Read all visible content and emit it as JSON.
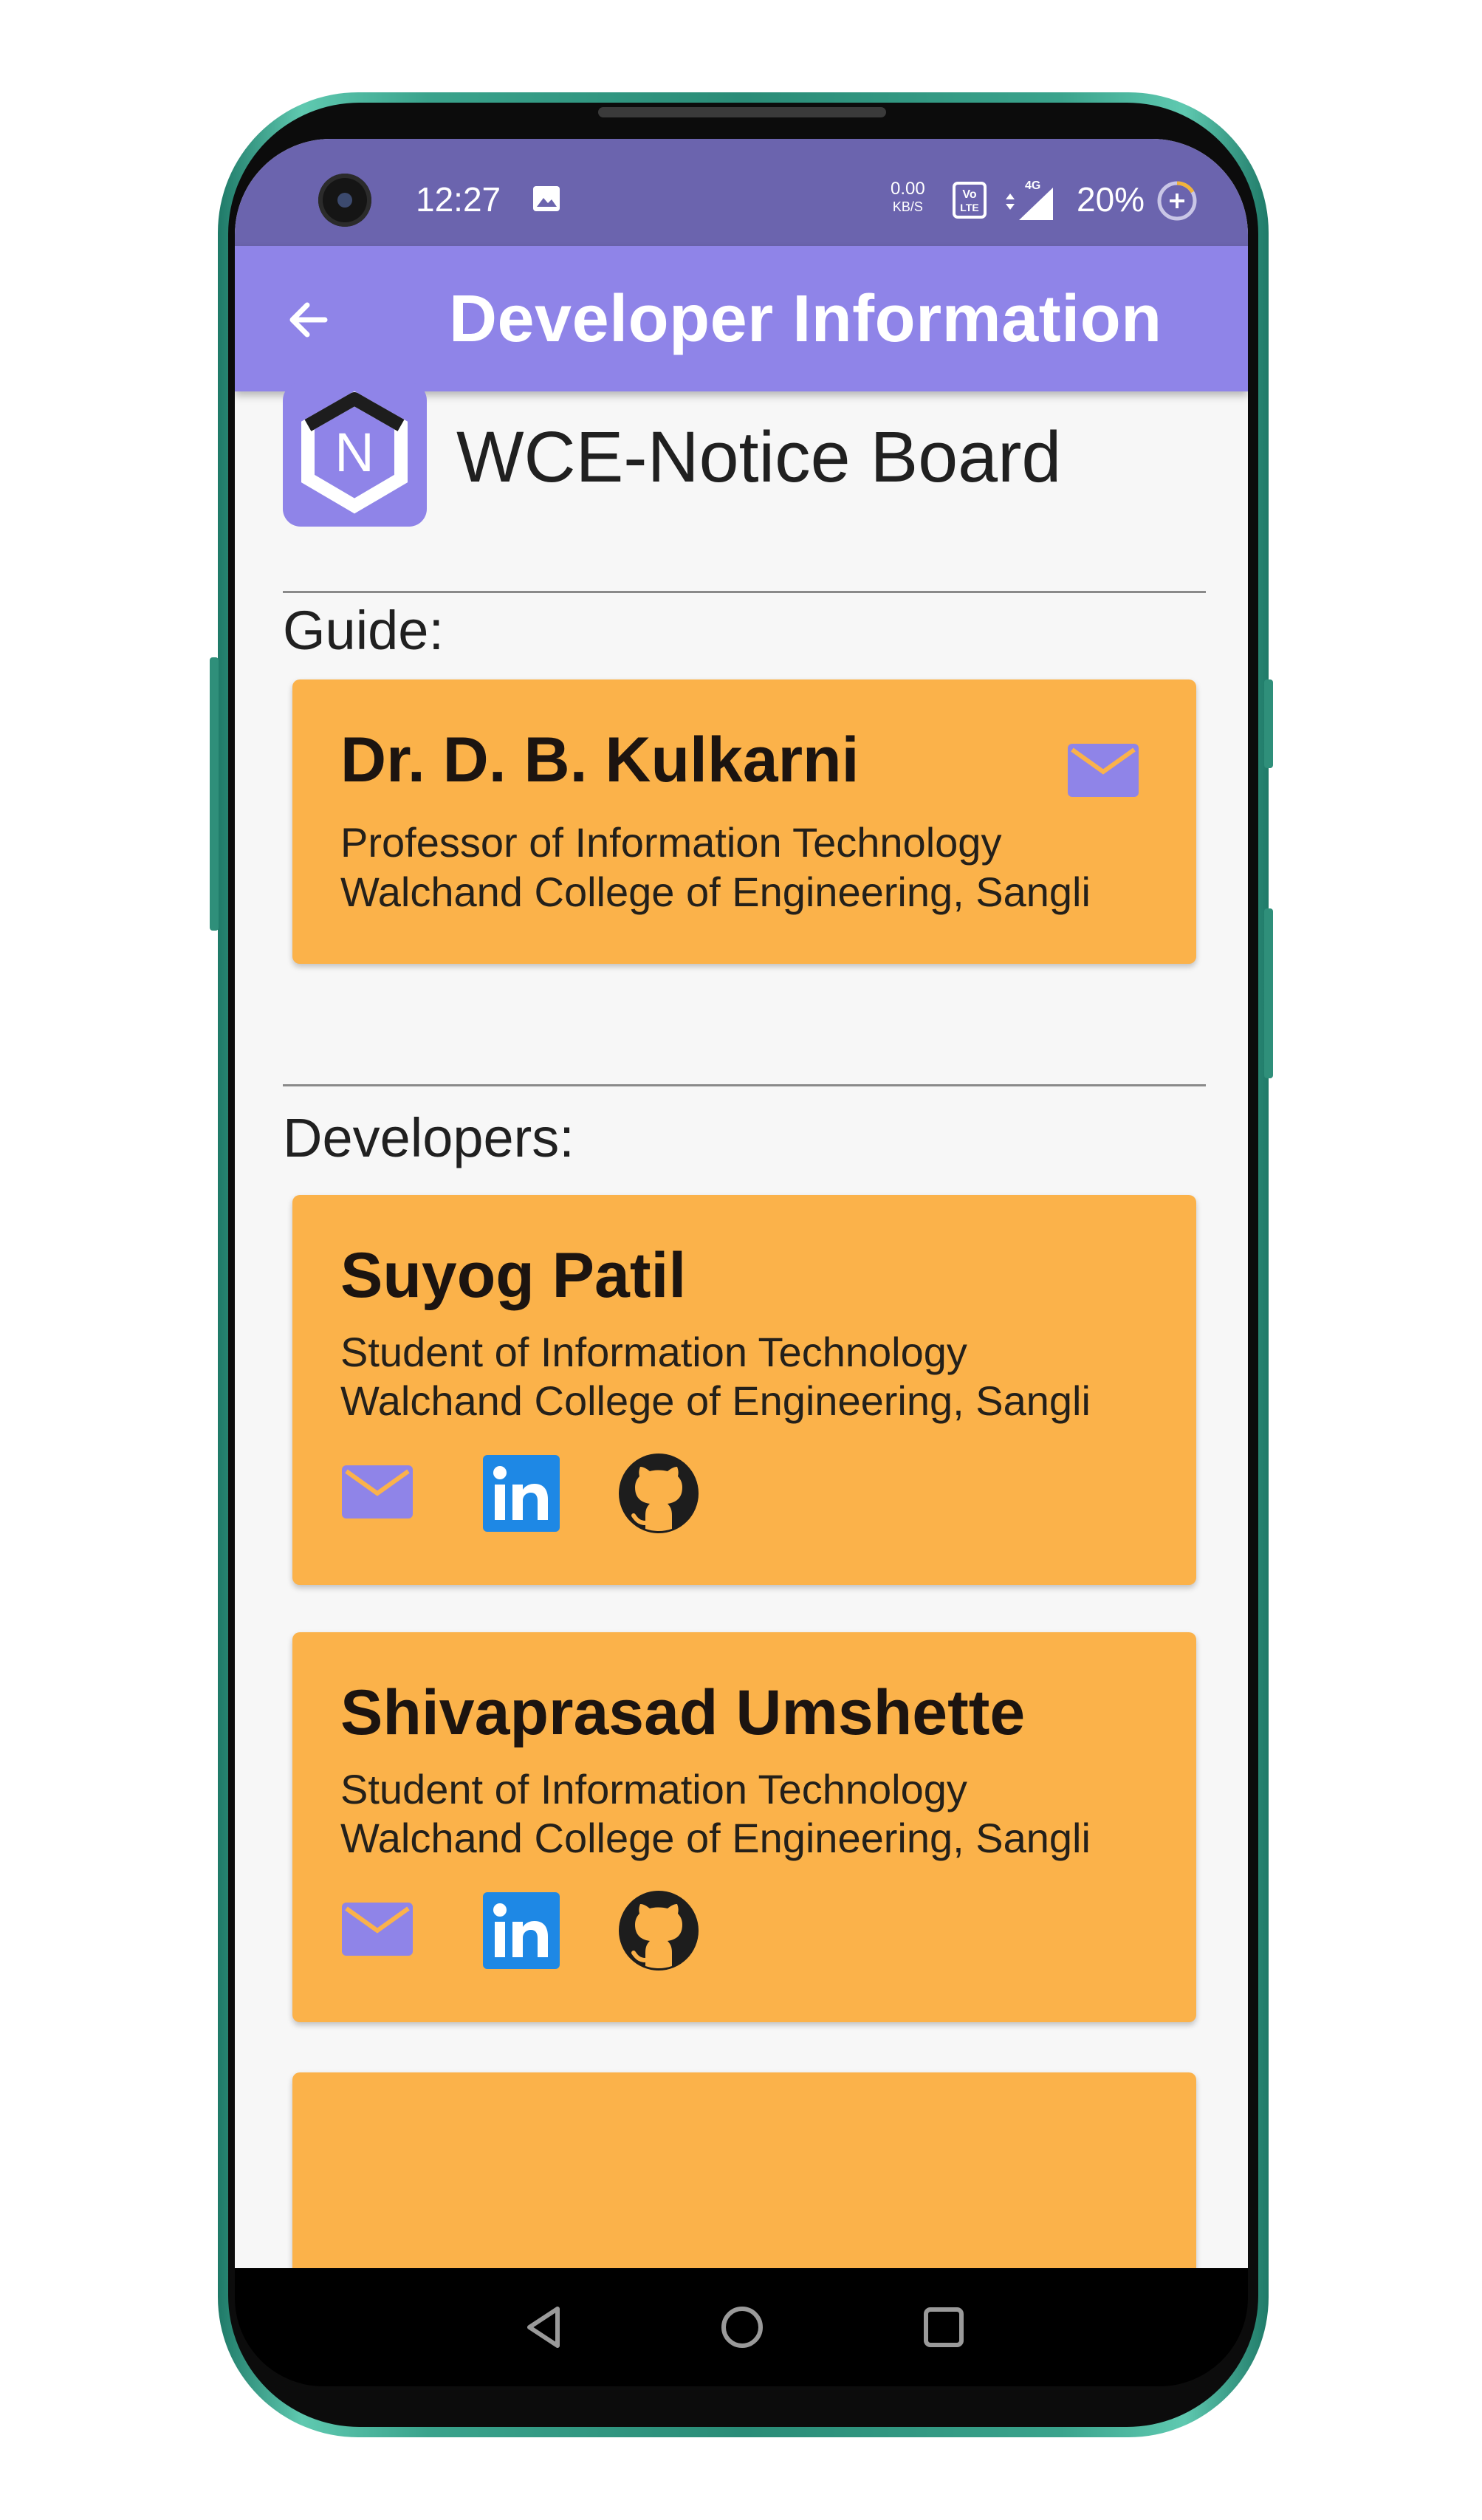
{
  "status_bar": {
    "time": "12:27",
    "net_speed_value": "0.00",
    "net_speed_unit": "KB/S",
    "volte": "Vo LTE",
    "network": "4G",
    "battery": "20%"
  },
  "app_bar": {
    "title": "Developer Information",
    "back_icon": "arrow-left-icon"
  },
  "app": {
    "logo_letter": "N",
    "name": "WCE-Notice Board"
  },
  "guide_section": {
    "label": "Guide:",
    "card": {
      "name": "Dr. D. B. Kulkarni",
      "role": "Professor of Information Technology",
      "institution": "Walchand College of Engineering, Sangli"
    }
  },
  "developers_section": {
    "label": "Developers:",
    "cards": [
      {
        "name": "Suyog Patil",
        "role": "Student of Information Technology",
        "institution": "Walchand College of Engineering, Sangli"
      },
      {
        "name": "Shivaprasad Umshette",
        "role": "Student of Information Technology",
        "institution": "Walchand College of Engineering, Sangli"
      }
    ]
  },
  "colors": {
    "app_bar": "#8f84e8",
    "status_bar": "#6b64ae",
    "card": "#fbb24a",
    "mail_icon": "#8f84e8",
    "linkedin": "#1e88e5"
  },
  "icons": {
    "mail": "mail-icon",
    "linkedin": "linkedin-icon",
    "github": "github-icon"
  },
  "nav_bar": {
    "buttons": [
      "back-triangle-icon",
      "home-circle-icon",
      "recents-square-icon"
    ]
  }
}
